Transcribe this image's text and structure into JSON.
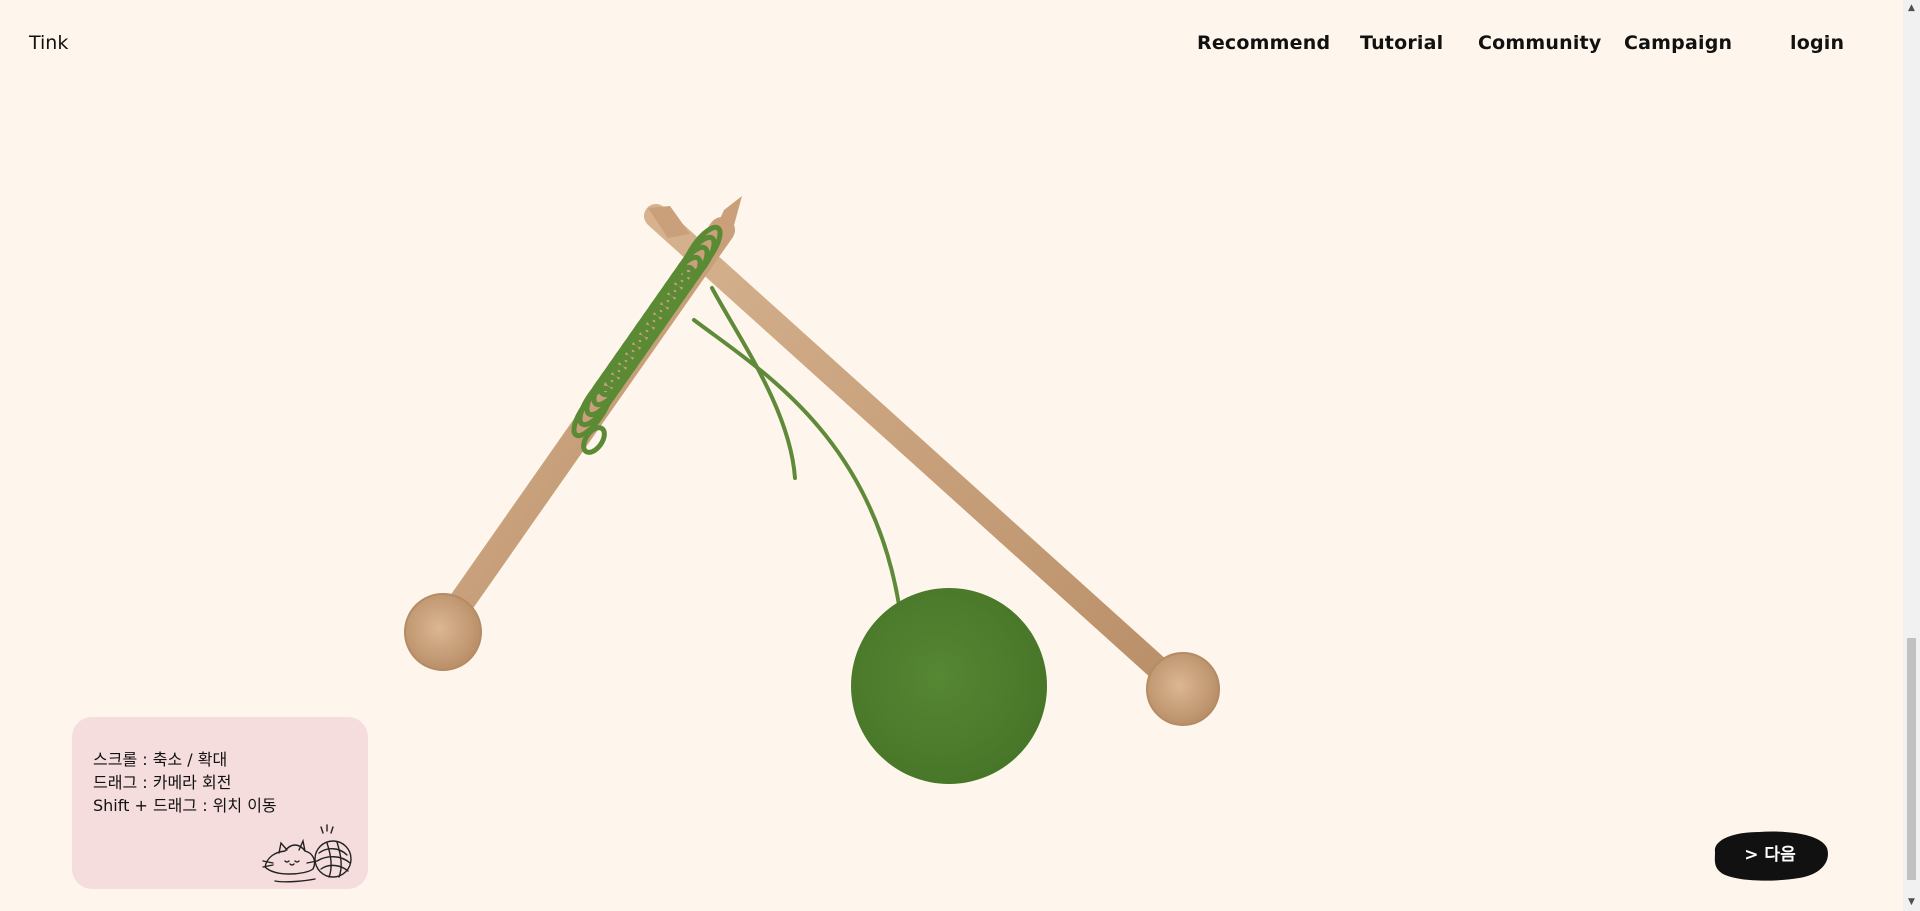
{
  "header": {
    "logo": "Tink",
    "nav": [
      {
        "label": "Recommend"
      },
      {
        "label": "Tutorial"
      },
      {
        "label": "Community"
      },
      {
        "label": "Campaign"
      },
      {
        "label": "login"
      }
    ]
  },
  "help": {
    "lines": [
      "스크롤 : 축소 / 확대",
      "드래그 : 카메라 회전",
      "Shift + 드래그 : 위치 이동"
    ]
  },
  "next_button": {
    "label": "> 다음"
  },
  "colors": {
    "background": "#fef6ec",
    "help_panel": "#f5dcdd",
    "needle": "#c9a27c",
    "yarn": "#4f7d2f",
    "button": "#111111"
  },
  "scrollbar": {
    "up_icon": "▲",
    "down_icon": "▼"
  }
}
